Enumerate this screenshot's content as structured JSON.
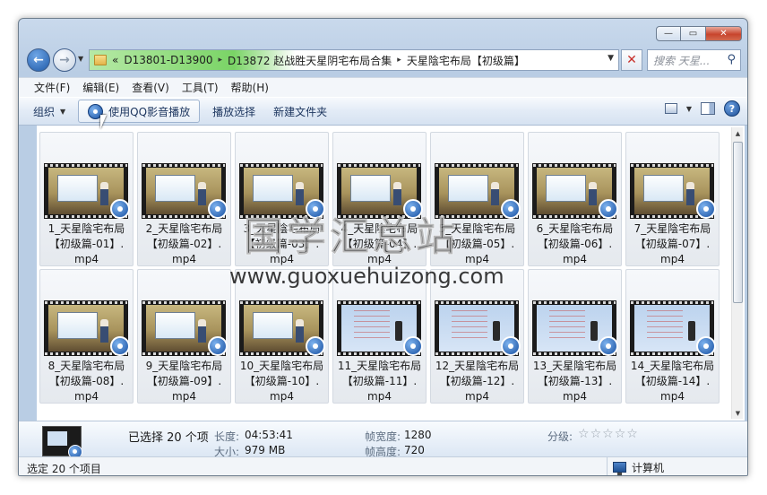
{
  "window": {
    "controls": {
      "minimize": "—",
      "maximize": "▭",
      "close": "✕"
    }
  },
  "address": {
    "segments": [
      "«",
      "D13801-D13900",
      "▸",
      "D13872 赵战胜天星阴宅布局合集",
      "▸",
      "天星陰宅布局【初级篇】"
    ],
    "search_placeholder": "搜索 天星..."
  },
  "menu": [
    "文件(F)",
    "编辑(E)",
    "查看(V)",
    "工具(T)",
    "帮助(H)"
  ],
  "toolbar": {
    "organize": "组织",
    "play_qq": "使用QQ影音播放",
    "play_selection": "播放选择",
    "new_folder": "新建文件夹"
  },
  "files": [
    {
      "line1": "1_天星陰宅布局",
      "line2": "【初级篇-01】.",
      "ext": "mp4",
      "thumb": "room"
    },
    {
      "line1": "2_天星陰宅布局",
      "line2": "【初级篇-02】.",
      "ext": "mp4",
      "thumb": "room"
    },
    {
      "line1": "3_天星陰宅布局",
      "line2": "【初级篇-03】.",
      "ext": "mp4",
      "thumb": "room"
    },
    {
      "line1": "4_天星陰宅布局",
      "line2": "【初级篇-04】.",
      "ext": "mp4",
      "thumb": "room"
    },
    {
      "line1": "5_天星陰宅布局",
      "line2": "【初级篇-05】.",
      "ext": "mp4",
      "thumb": "room"
    },
    {
      "line1": "6_天星陰宅布局",
      "line2": "【初级篇-06】.",
      "ext": "mp4",
      "thumb": "room"
    },
    {
      "line1": "7_天星陰宅布局",
      "line2": "【初级篇-07】.",
      "ext": "mp4",
      "thumb": "room"
    },
    {
      "line1": "8_天星陰宅布局",
      "line2": "【初级篇-08】.",
      "ext": "mp4",
      "thumb": "room"
    },
    {
      "line1": "9_天星陰宅布局",
      "line2": "【初级篇-09】.",
      "ext": "mp4",
      "thumb": "room"
    },
    {
      "line1": "10_天星陰宅布局",
      "line2": "【初级篇-10】.",
      "ext": "mp4",
      "thumb": "room"
    },
    {
      "line1": "11_天星陰宅布局",
      "line2": "【初级篇-11】.",
      "ext": "mp4",
      "thumb": "slide"
    },
    {
      "line1": "12_天星陰宅布局",
      "line2": "【初级篇-12】.",
      "ext": "mp4",
      "thumb": "slide"
    },
    {
      "line1": "13_天星陰宅布局",
      "line2": "【初级篇-13】.",
      "ext": "mp4",
      "thumb": "slide"
    },
    {
      "line1": "14_天星陰宅布局",
      "line2": "【初级篇-14】.",
      "ext": "mp4",
      "thumb": "slide"
    }
  ],
  "details": {
    "selected": "已选择 20 个项",
    "length_label": "长度:",
    "length_value": "04:53:41",
    "size_label": "大小:",
    "size_value": "979 MB",
    "width_label": "帧宽度:",
    "width_value": "1280",
    "height_label": "帧高度:",
    "height_value": "720",
    "rating_label": "分级:",
    "rating_value": 0
  },
  "status": {
    "left": "选定 20 个项目",
    "right": "计算机"
  },
  "watermark": {
    "cn": "国学汇总站",
    "url": "www.guoxuehuizong.com"
  }
}
